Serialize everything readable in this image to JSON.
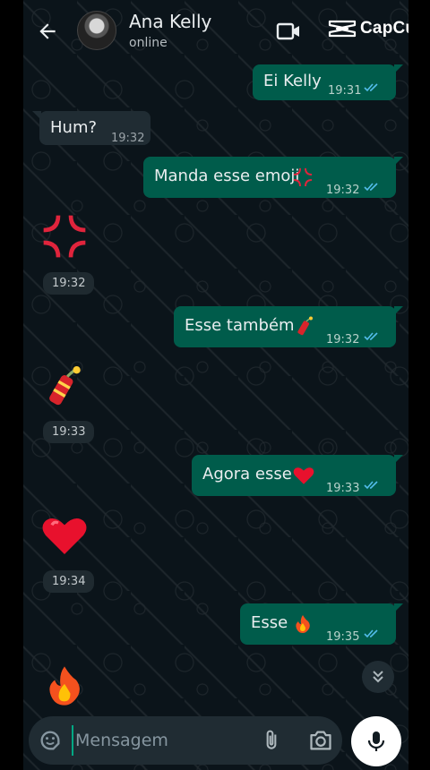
{
  "header": {
    "contact_name": "Ana Kelly",
    "status": "online",
    "watermark": "CapCut"
  },
  "icons": {
    "back": "arrow-left-icon",
    "video": "video-camera-icon",
    "watermark_logo": "capcut-logo-icon",
    "sticker": "sticker-icon",
    "attach": "paperclip-icon",
    "camera": "camera-icon",
    "mic": "microphone-icon",
    "scroll": "double-chevron-down-icon",
    "read_receipt": "double-check-icon"
  },
  "colors": {
    "outgoing_bubble": "#005c4b",
    "incoming_bubble": "#202c33",
    "chat_background": "#0b141a",
    "read_ticks": "#53bdeb",
    "accent": "#00a884"
  },
  "messages": [
    {
      "direction": "out",
      "text": "Ei Kelly",
      "time": "19:31"
    },
    {
      "direction": "in",
      "text": "Hum?",
      "time": "19:32"
    },
    {
      "direction": "out",
      "text": "Manda esse emoji",
      "emoji": "anger-symbol",
      "time": "19:32"
    },
    {
      "direction": "in",
      "emoji": "anger-symbol",
      "time": "19:32"
    },
    {
      "direction": "out",
      "text": "Esse também",
      "emoji": "firecracker",
      "time": "19:32"
    },
    {
      "direction": "in",
      "emoji": "firecracker",
      "time": "19:33"
    },
    {
      "direction": "out",
      "text": "Agora esse",
      "emoji": "red-heart",
      "time": "19:33"
    },
    {
      "direction": "in",
      "emoji": "red-heart",
      "time": "19:34"
    },
    {
      "direction": "out",
      "text": "Esse",
      "emoji": "fire",
      "time": "19:35"
    },
    {
      "direction": "in",
      "emoji": "fire"
    }
  ],
  "composer": {
    "placeholder": "Mensagem"
  }
}
